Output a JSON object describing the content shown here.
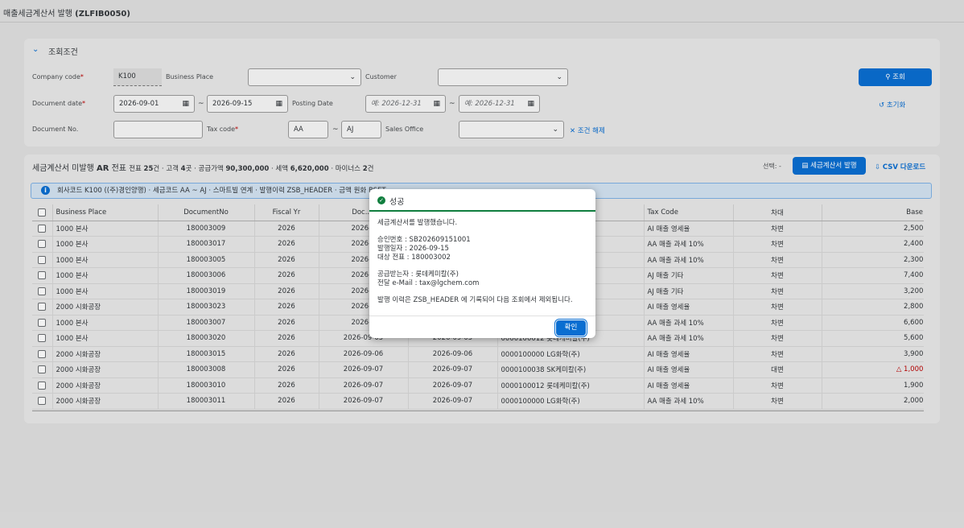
{
  "app": {
    "title_prefix": "매출세금계산서 발행",
    "title_code": "(ZLFIB0050)"
  },
  "filter": {
    "collapse_icon": "chevron-down-icon",
    "title": "조회조건",
    "company_code_label": "Company code",
    "company_code_value": "K100",
    "business_place_label": "Business Place",
    "customer_label": "Customer",
    "document_date_label": "Document date",
    "document_date_from": "2026-09-01",
    "document_date_to": "2026-09-15",
    "posting_date_label": "Posting Date",
    "posting_date_from_ph": "예: 2026-12-31",
    "posting_date_to_ph": "예: 2026-12-31",
    "document_no_label": "Document No.",
    "tax_code_label": "Tax code",
    "tax_code_from": "AA",
    "tax_code_to": "AJ",
    "sales_office_label": "Sales Office",
    "clear_label": "✕ 조건 해제",
    "search_label": "조회",
    "reset_label": "초기화",
    "required_mark": "*",
    "tilde": "~"
  },
  "table": {
    "title": "세금계산서 미발행",
    "title_bold": "AR",
    "title_suffix": "전표",
    "summary": {
      "t1": "전표",
      "v1": "25",
      "t2": "건 · 고객",
      "v2": "4",
      "t3": "곳 · 공급가액",
      "v3": "90,300,000",
      "t4": "· 세액",
      "v4": "6,620,000",
      "t5": "· 마이너스",
      "v5": "2",
      "t6": "건"
    },
    "selection_label": "선택: -",
    "issue_button": "세금계산서 발행",
    "csv_button": "CSV 다운로드",
    "info": "회사코드 K100 ((주)경인양행) · 세금코드 AA ~ AJ · 스마트빌 연계 · 발행이력 ZSB_HEADER · 금액 원화 BSET",
    "columns": [
      "Business Place",
      "DocumentNo",
      "Fiscal Yr",
      "Doc..D",
      "",
      "",
      "Tax Code",
      "차대",
      "Base A"
    ],
    "rows": [
      {
        "bp": "1000 본사",
        "doc": "180003009",
        "fy": "2026",
        "d1": "2026-0",
        "d2": "",
        "cust": "",
        "tax": "AI 매출 영세율",
        "dc": "차변",
        "amt": "2,500,0"
      },
      {
        "bp": "1000 본사",
        "doc": "180003017",
        "fy": "2026",
        "d1": "2026-0",
        "d2": "",
        "cust": "",
        "tax": "AA 매출 과세 10%",
        "dc": "차변",
        "amt": "2,400,0"
      },
      {
        "bp": "1000 본사",
        "doc": "180003005",
        "fy": "2026",
        "d1": "2026-0",
        "d2": "",
        "cust": "",
        "tax": "AA 매출 과세 10%",
        "dc": "차변",
        "amt": "2,300,0"
      },
      {
        "bp": "1000 본사",
        "doc": "180003006",
        "fy": "2026",
        "d1": "2026-0",
        "d2": "",
        "cust": "",
        "tax": "AJ 매출 기타",
        "dc": "차변",
        "amt": "7,400,0"
      },
      {
        "bp": "1000 본사",
        "doc": "180003019",
        "fy": "2026",
        "d1": "2026-0",
        "d2": "",
        "cust": "",
        "tax": "AJ 매출 기타",
        "dc": "차변",
        "amt": "3,200,0"
      },
      {
        "bp": "2000 시화공장",
        "doc": "180003023",
        "fy": "2026",
        "d1": "2026-0",
        "d2": "",
        "cust": "",
        "tax": "AI 매출 영세율",
        "dc": "차변",
        "amt": "2,800,0"
      },
      {
        "bp": "1000 본사",
        "doc": "180003007",
        "fy": "2026",
        "d1": "2026-0",
        "d2": "",
        "cust": "",
        "tax": "AA 매출 과세 10%",
        "dc": "차변",
        "amt": "6,600,0"
      },
      {
        "bp": "1000 본사",
        "doc": "180003020",
        "fy": "2026",
        "d1": "2026-09-05",
        "d2": "2026-09-05",
        "cust": "0000100012 롯데케미칼(주)",
        "tax": "AA 매출 과세 10%",
        "dc": "차변",
        "amt": "5,600,0"
      },
      {
        "bp": "2000 시화공장",
        "doc": "180003015",
        "fy": "2026",
        "d1": "2026-09-06",
        "d2": "2026-09-06",
        "cust": "0000100000 LG화학(주)",
        "tax": "AI 매출 영세율",
        "dc": "차변",
        "amt": "3,900,0"
      },
      {
        "bp": "2000 시화공장",
        "doc": "180003008",
        "fy": "2026",
        "d1": "2026-09-07",
        "d2": "2026-09-07",
        "cust": "0000100038 SK케미칼(주)",
        "tax": "AI 매출 영세율",
        "dc": "대변",
        "amt": "△ 1,000,0",
        "neg": true
      },
      {
        "bp": "2000 시화공장",
        "doc": "180003010",
        "fy": "2026",
        "d1": "2026-09-07",
        "d2": "2026-09-07",
        "cust": "0000100012 롯데케미칼(주)",
        "tax": "AI 매출 영세율",
        "dc": "차변",
        "amt": "1,900,0"
      },
      {
        "bp": "2000 시화공장",
        "doc": "180003011",
        "fy": "2026",
        "d1": "2026-09-07",
        "d2": "2026-09-07",
        "cust": "0000100000 LG화학(주)",
        "tax": "AA 매출 과세 10%",
        "dc": "차변",
        "amt": "2,000,0"
      }
    ]
  },
  "dialog": {
    "title": "성공",
    "line1": "세금계산서를 발행했습니다.",
    "line2": "승인번호 : SB202609151001",
    "line3": "발행일자 : 2026-09-15",
    "line4": "대상 전표 : 180003002",
    "line5": "공급받는자 : 롯데케미칼(주)",
    "line6": "전달 e-Mail : tax@lgchem.com",
    "line7": "발행 이력은 ZSB_HEADER 에 기록되어 다음 조회에서 제외됩니다.",
    "confirm": "확인"
  },
  "colors": {
    "accent": "#0a6ed1",
    "success": "#107e3e",
    "negative": "#bb0000",
    "marker": "#e9730c"
  }
}
